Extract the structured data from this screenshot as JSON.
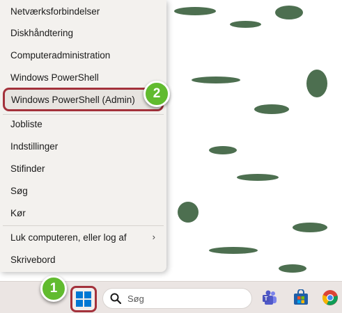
{
  "menu": {
    "items": [
      {
        "label": "Netværksforbindelser"
      },
      {
        "label": "Diskhåndtering"
      },
      {
        "label": "Computeradministration"
      },
      {
        "label": "Windows PowerShell"
      },
      {
        "label": "Windows PowerShell (Admin)",
        "highlighted": true
      },
      {
        "label": "Jobliste"
      },
      {
        "label": "Indstillinger"
      },
      {
        "label": "Stifinder"
      },
      {
        "label": "Søg"
      },
      {
        "label": "Kør"
      },
      {
        "label": "Luk computeren, eller log af",
        "submenu": true
      },
      {
        "label": "Skrivebord"
      }
    ]
  },
  "steps": {
    "one": "1",
    "two": "2"
  },
  "taskbar": {
    "search_label": "Søg",
    "icons": [
      "windows-logo-icon",
      "search-icon",
      "teams-icon",
      "microsoft-store-icon",
      "chrome-icon"
    ]
  },
  "colors": {
    "highlight_border": "#a3313b",
    "badge": "#61bb2f",
    "windows_blue": "#0078d4"
  }
}
